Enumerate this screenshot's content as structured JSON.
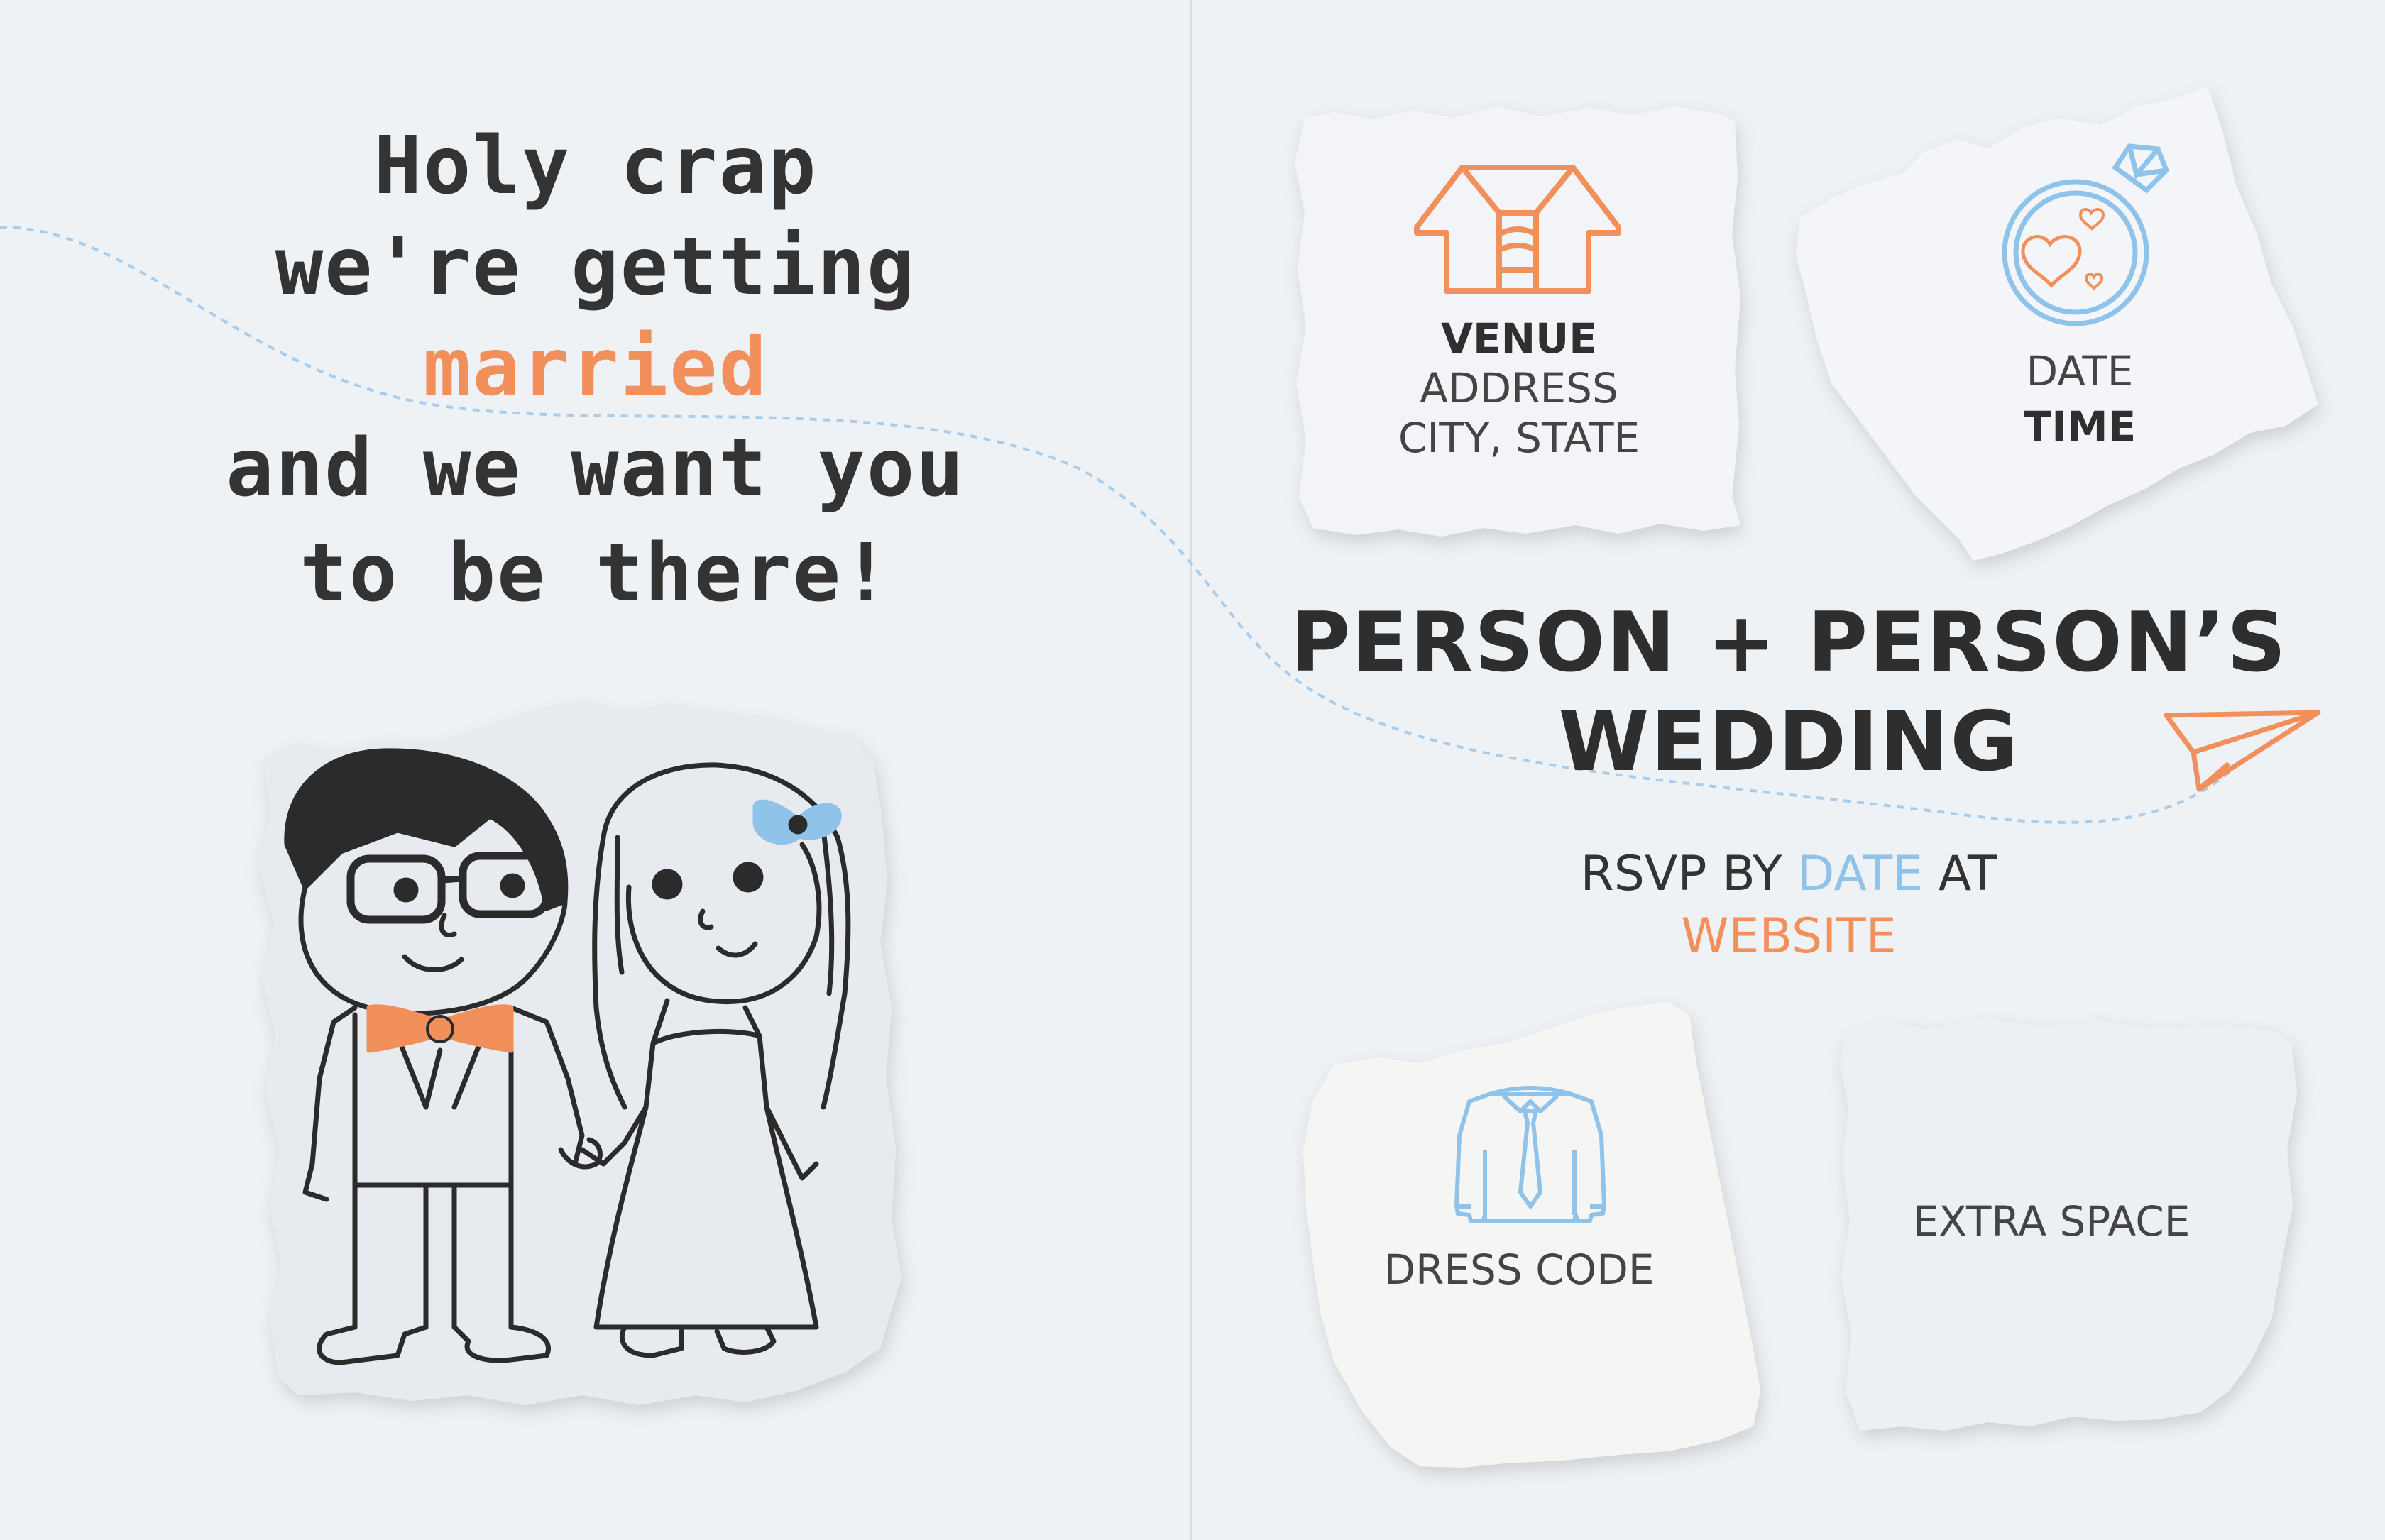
{
  "headline": {
    "line1": "Holy crap",
    "line2": "we're getting",
    "married": "married",
    "line4": "and we want you",
    "line5": "to be there!"
  },
  "venue": {
    "title": "VENUE",
    "address": "ADDRESS",
    "city_state": "CITY, STATE",
    "icon": "venue-building-icon"
  },
  "when": {
    "date": "DATE",
    "time": "TIME",
    "icon": "ring-icon"
  },
  "title": {
    "line1": "PERSON + PERSON’S",
    "line2": "WEDDING"
  },
  "rsvp": {
    "prefix": "RSVP BY",
    "date": "DATE",
    "at": "AT",
    "website": "WEBSITE"
  },
  "dress": {
    "label": "DRESS CODE",
    "icon": "shirt-tie-icon"
  },
  "extra": {
    "label": "EXTRA SPACE"
  },
  "illustration": {
    "icon": "couple-drawing-icon"
  },
  "decor": {
    "plane_icon": "paper-plane-icon"
  },
  "colors": {
    "accent_orange": "#f2905c",
    "accent_blue": "#8fc3ea",
    "text_dark": "#333333",
    "background": "#eff2f5"
  }
}
